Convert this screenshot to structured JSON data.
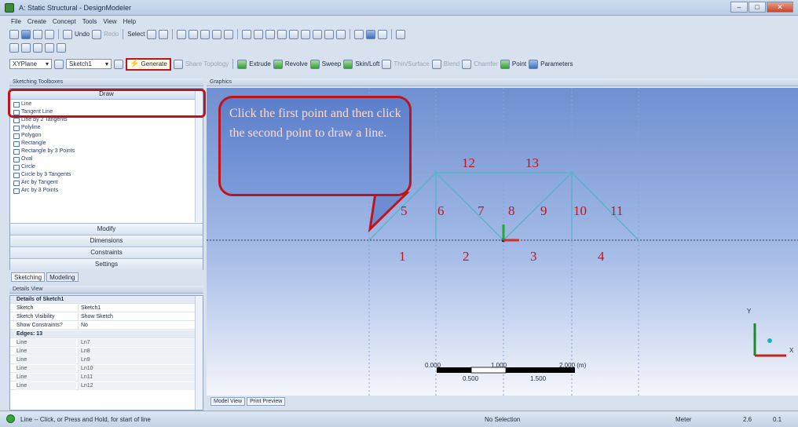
{
  "window": {
    "title": "A: Static Structural - DesignModeler"
  },
  "menu": [
    "File",
    "Create",
    "Concept",
    "Tools",
    "View",
    "Help"
  ],
  "toolbar": {
    "undo": "Undo",
    "redo": "Redo",
    "select": "Select",
    "plane": "XYPlane",
    "sketch": "Sketch1",
    "generate": "Generate",
    "share_topology": "Share Topology",
    "extrude": "Extrude",
    "revolve": "Revolve",
    "sweep": "Sweep",
    "skin_loft": "Skin/Loft",
    "thin_surface": "Thin/Surface",
    "blend": "Blend",
    "chamfer": "Chamfer",
    "point": "Point",
    "parameters": "Parameters"
  },
  "sketching_toolboxes": {
    "title": "Sketching Toolboxes",
    "draw": "Draw",
    "tools": [
      "Line",
      "Tangent Line",
      "Line by 2 Tangents",
      "Polyline",
      "Polygon",
      "Rectangle",
      "Rectangle by 3 Points",
      "Oval",
      "Circle",
      "Circle by 3 Tangents",
      "Arc by Tangent",
      "Arc by 3 Points"
    ],
    "modify": "Modify",
    "dimensions": "Dimensions",
    "constraints": "Constraints",
    "settings": "Settings"
  },
  "tabs": {
    "sketching": "Sketching",
    "modeling": "Modeling"
  },
  "details": {
    "title": "Details View",
    "header": "Details of Sketch1",
    "rows": [
      {
        "k": "Sketch",
        "v": "Sketch1"
      },
      {
        "k": "Sketch Visibility",
        "v": "Show Sketch"
      },
      {
        "k": "Show Constraints?",
        "v": "No"
      }
    ],
    "edges_header": "Edges: 13",
    "edges": [
      {
        "k": "Line",
        "v": "Ln7"
      },
      {
        "k": "Line",
        "v": "Ln8"
      },
      {
        "k": "Line",
        "v": "Ln9"
      },
      {
        "k": "Line",
        "v": "Ln10"
      },
      {
        "k": "Line",
        "v": "Ln11"
      },
      {
        "k": "Line",
        "v": "Ln12"
      }
    ]
  },
  "graphics": {
    "title": "Graphics",
    "callout": "Click the first point and then click the second point to draw a line.",
    "member_labels": [
      "1",
      "2",
      "3",
      "4",
      "5",
      "6",
      "7",
      "8",
      "9",
      "10",
      "11",
      "12",
      "13"
    ],
    "scale": {
      "left": "0.000",
      "mid": "1.000",
      "right": "2.000 (m)",
      "q1": "0.500",
      "q3": "1.500"
    },
    "axes": {
      "x": "X",
      "y": "Y"
    }
  },
  "view_tabs": {
    "model": "Model View",
    "print": "Print Preview"
  },
  "status": {
    "hint": "Line -- Click, or Press and Hold, for start of line",
    "selection": "No Selection",
    "units": "Meter",
    "v1": "2.6",
    "v2": "0.1"
  },
  "colors": {
    "highlight": "#c0141c",
    "truss": "#5ab4c9",
    "labels": "#c4141c"
  }
}
